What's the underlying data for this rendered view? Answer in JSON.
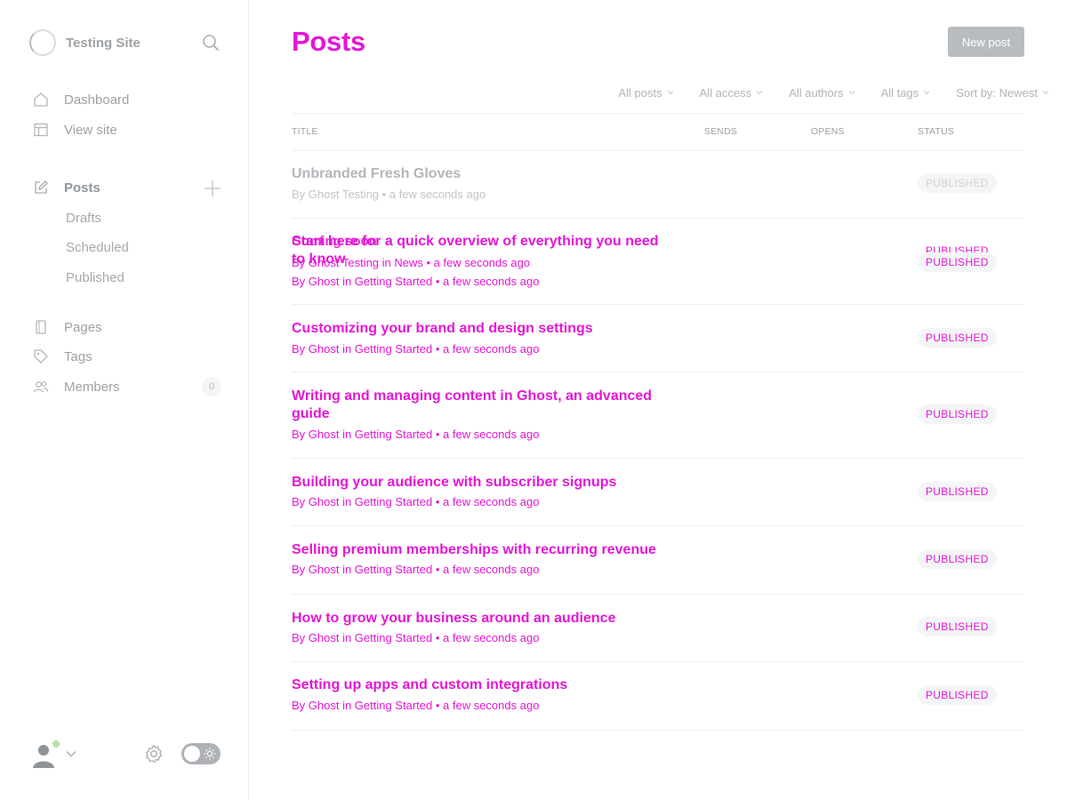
{
  "sidebar": {
    "site_title": "Testing Site",
    "nav": [
      {
        "label": "Dashboard",
        "icon": "home-icon"
      },
      {
        "label": "View site",
        "icon": "layout-icon"
      }
    ],
    "posts": {
      "label": "Posts",
      "icon": "edit-icon"
    },
    "sub_items": [
      {
        "label": "Drafts"
      },
      {
        "label": "Scheduled"
      },
      {
        "label": "Published"
      }
    ],
    "nav2": [
      {
        "label": "Pages",
        "icon": "page-icon"
      },
      {
        "label": "Tags",
        "icon": "tag-icon"
      },
      {
        "label": "Members",
        "icon": "members-icon"
      }
    ],
    "members_count": "0"
  },
  "header": {
    "title": "Posts",
    "new_post_label": "New post"
  },
  "filters": [
    {
      "label": "All posts"
    },
    {
      "label": "All access"
    },
    {
      "label": "All authors"
    },
    {
      "label": "All tags"
    },
    {
      "label": "Sort by: Newest"
    }
  ],
  "columns": {
    "title": "TITLE",
    "sends": "SENDS",
    "opens": "OPENS",
    "status": "STATUS"
  },
  "posts": [
    {
      "title": "Unbranded Fresh Gloves",
      "meta": "By Ghost Testing • a few seconds ago",
      "status": "PUBLISHED"
    },
    {
      "title": "Start here for a quick overview of everything you need to know",
      "meta": "By Ghost in Getting Started • a few seconds ago",
      "status": "PUBLISHED"
    },
    {
      "title": "Customizing your brand and design settings",
      "meta": "By Ghost in Getting Started • a few seconds ago",
      "status": "PUBLISHED"
    },
    {
      "title": "Writing and managing content in Ghost, an advanced guide",
      "meta": "By Ghost in Getting Started • a few seconds ago",
      "status": "PUBLISHED"
    },
    {
      "title": "Building your audience with subscriber signups",
      "meta": "By Ghost in Getting Started • a few seconds ago",
      "status": "PUBLISHED"
    },
    {
      "title": "Selling premium memberships with recurring revenue",
      "meta": "By Ghost in Getting Started • a few seconds ago",
      "status": "PUBLISHED"
    },
    {
      "title": "How to grow your business around an audience",
      "meta": "By Ghost in Getting Started • a few seconds ago",
      "status": "PUBLISHED"
    },
    {
      "title": "Setting up apps and custom integrations",
      "meta": "By Ghost in Getting Started • a few seconds ago",
      "status": "PUBLISHED"
    }
  ],
  "ghost_row": {
    "title": "Coming soon",
    "meta": "By Ghost Testing in News • a few seconds ago",
    "status": "PUBLISHED"
  },
  "colors": {
    "accent": "#e616d6",
    "muted_text": "#9ea2a6",
    "online": "#b5e4a5"
  }
}
